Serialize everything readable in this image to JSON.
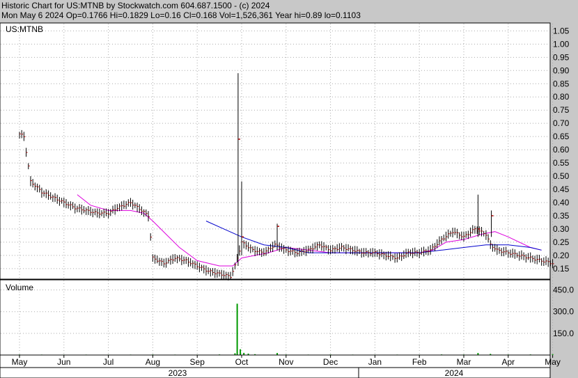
{
  "header": {
    "line1": "Historic Chart for US:MTNB by Stockwatch.com 604.687.1500 - (c) 2024",
    "line2": "Mon May  6 2024   Op=0.1766   Hi=0.1829   Lo=0.16   Cl=0.168   Vol=1,526,361   Year hi=0.89   lo=0.1103"
  },
  "colors": {
    "background": "#c8c8c8",
    "plot_bg": "#ffffff",
    "bar_up": "#000000",
    "bar_close": "#aa0000",
    "ma_short": "#dd00dd",
    "ma_long": "#0000cc",
    "grid": "#aaaaaa",
    "volume": "#009900"
  },
  "chart_data": [
    {
      "type": "ohlc",
      "panel_label": "US:MTNB",
      "x_categories": [
        "May",
        "Jun",
        "Jul",
        "Aug",
        "Sep",
        "Oct",
        "Nov",
        "Dec",
        "Jan",
        "Feb",
        "Mar",
        "Apr",
        "May"
      ],
      "years": [
        "2023",
        "2024"
      ],
      "ylim": [
        0.11,
        1.08
      ],
      "y_ticks": [
        "0.15",
        "0.20",
        "0.25",
        "0.30",
        "0.35",
        "0.40",
        "0.45",
        "0.50",
        "0.55",
        "0.60",
        "0.65",
        "0.70",
        "0.75",
        "0.80",
        "0.85",
        "0.90",
        "0.95",
        "1.00",
        "1.05"
      ],
      "grid": true,
      "price": [
        [
          0,
          0.66
        ],
        [
          0.1,
          0.65
        ],
        [
          0.25,
          0.48
        ],
        [
          0.5,
          0.44
        ],
        [
          0.75,
          0.42
        ],
        [
          1,
          0.4
        ],
        [
          1.25,
          0.38
        ],
        [
          1.5,
          0.37
        ],
        [
          1.75,
          0.36
        ],
        [
          2,
          0.36
        ],
        [
          2.2,
          0.38
        ],
        [
          2.5,
          0.4
        ],
        [
          2.75,
          0.37
        ],
        [
          2.9,
          0.35
        ],
        [
          3,
          0.19
        ],
        [
          3.25,
          0.17
        ],
        [
          3.5,
          0.19
        ],
        [
          3.75,
          0.18
        ],
        [
          4,
          0.16
        ],
        [
          4.25,
          0.14
        ],
        [
          4.5,
          0.13
        ],
        [
          4.75,
          0.12
        ],
        [
          4.85,
          0.16
        ],
        [
          5,
          0.25
        ],
        [
          5.25,
          0.22
        ],
        [
          5.5,
          0.21
        ],
        [
          5.75,
          0.24
        ],
        [
          6,
          0.22
        ],
        [
          6.25,
          0.21
        ],
        [
          6.5,
          0.22
        ],
        [
          6.75,
          0.24
        ],
        [
          7,
          0.22
        ],
        [
          7.25,
          0.23
        ],
        [
          7.5,
          0.22
        ],
        [
          7.75,
          0.21
        ],
        [
          8,
          0.21
        ],
        [
          8.25,
          0.2
        ],
        [
          8.5,
          0.19
        ],
        [
          8.75,
          0.21
        ],
        [
          9,
          0.21
        ],
        [
          9.25,
          0.22
        ],
        [
          9.5,
          0.26
        ],
        [
          9.75,
          0.29
        ],
        [
          10,
          0.27
        ],
        [
          10.25,
          0.3
        ],
        [
          10.5,
          0.28
        ],
        [
          10.6,
          0.24
        ],
        [
          10.75,
          0.22
        ],
        [
          11,
          0.21
        ],
        [
          11.25,
          0.2
        ],
        [
          11.5,
          0.19
        ],
        [
          11.75,
          0.18
        ],
        [
          12,
          0.17
        ]
      ],
      "spikes": [
        {
          "x": 4.92,
          "high": 0.89,
          "low": 0.16,
          "close": 0.64
        },
        {
          "x": 5.0,
          "high": 0.48,
          "low": 0.2,
          "close": 0.27
        },
        {
          "x": 5.8,
          "high": 0.32,
          "low": 0.22,
          "close": 0.31
        },
        {
          "x": 10.32,
          "high": 0.43,
          "low": 0.27,
          "close": 0.3
        },
        {
          "x": 10.62,
          "high": 0.37,
          "low": 0.27,
          "close": 0.35
        }
      ],
      "ma_short": [
        [
          1.3,
          0.43
        ],
        [
          1.6,
          0.39
        ],
        [
          2,
          0.37
        ],
        [
          2.5,
          0.37
        ],
        [
          2.8,
          0.36
        ],
        [
          3,
          0.33
        ],
        [
          3.3,
          0.28
        ],
        [
          3.6,
          0.23
        ],
        [
          4,
          0.18
        ],
        [
          4.5,
          0.16
        ],
        [
          4.8,
          0.16
        ],
        [
          5,
          0.19
        ],
        [
          5.3,
          0.2
        ],
        [
          5.6,
          0.21
        ],
        [
          6,
          0.23
        ],
        [
          6.5,
          0.22
        ],
        [
          7,
          0.21
        ],
        [
          8,
          0.21
        ],
        [
          9,
          0.21
        ],
        [
          9.3,
          0.22
        ],
        [
          9.6,
          0.25
        ],
        [
          10,
          0.26
        ],
        [
          10.4,
          0.28
        ],
        [
          10.7,
          0.29
        ],
        [
          11,
          0.27
        ],
        [
          11.5,
          0.23
        ],
        [
          11.75,
          0.22
        ]
      ],
      "ma_long": [
        [
          4.2,
          0.33
        ],
        [
          4.6,
          0.3
        ],
        [
          5,
          0.27
        ],
        [
          5.5,
          0.24
        ],
        [
          6,
          0.23
        ],
        [
          6.5,
          0.21
        ],
        [
          7,
          0.21
        ],
        [
          8,
          0.21
        ],
        [
          9,
          0.21
        ],
        [
          9.5,
          0.22
        ],
        [
          10,
          0.23
        ],
        [
          10.5,
          0.24
        ],
        [
          11,
          0.24
        ],
        [
          11.5,
          0.23
        ],
        [
          11.75,
          0.22
        ]
      ]
    },
    {
      "type": "bar",
      "panel_label": "Volume",
      "ylim": [
        0,
        520
      ],
      "y_ticks": [
        "150.0",
        "300.0",
        "450.0"
      ],
      "values": [
        [
          0,
          4
        ],
        [
          0.5,
          3
        ],
        [
          1,
          3
        ],
        [
          1.5,
          3
        ],
        [
          2,
          3
        ],
        [
          2.5,
          3
        ],
        [
          3,
          4
        ],
        [
          3.5,
          3
        ],
        [
          4,
          3
        ],
        [
          4.5,
          4
        ],
        [
          4.85,
          12
        ],
        [
          4.9,
          355
        ],
        [
          4.97,
          40
        ],
        [
          5.05,
          15
        ],
        [
          5.15,
          10
        ],
        [
          5.3,
          6
        ],
        [
          5.8,
          14
        ],
        [
          6,
          4
        ],
        [
          6.5,
          3
        ],
        [
          7,
          4
        ],
        [
          7.5,
          3
        ],
        [
          8,
          3
        ],
        [
          8.5,
          3
        ],
        [
          9,
          3
        ],
        [
          9.5,
          4
        ],
        [
          10,
          4
        ],
        [
          10.32,
          14
        ],
        [
          10.6,
          8
        ],
        [
          11,
          4
        ],
        [
          11.5,
          4
        ],
        [
          12,
          6
        ]
      ]
    }
  ]
}
